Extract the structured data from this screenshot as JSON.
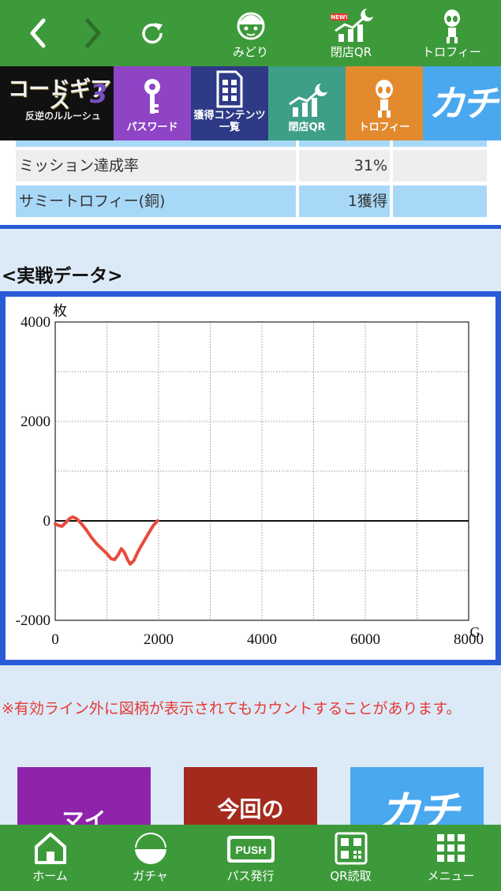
{
  "topbar": {
    "midori_label": "みどり",
    "qr_label": "閉店QR",
    "new_badge": "NEW!",
    "trophy_label": "トロフィー"
  },
  "gamebar": {
    "logo_text": "コードギアス",
    "logo_sub": "反逆のルルーシュ",
    "logo_num": "3",
    "password_label": "パスワード",
    "contents_label_1": "獲得コンテンツ",
    "contents_label_2": "一覧",
    "qr_label": "閉店QR",
    "trophy_label": "トロフィー",
    "kachi_text": "カチ"
  },
  "stats": [
    {
      "label": "ミッション達成率",
      "value": "31%"
    },
    {
      "label": "サミートロフィー(銅)",
      "value": "1獲得"
    }
  ],
  "section_title": "<実戦データ>",
  "chart_data": {
    "type": "line",
    "ylabel": "枚",
    "xlabel": "G",
    "ylim": [
      -2000,
      4000
    ],
    "xlim": [
      0,
      8000
    ],
    "y_ticks": [
      "4000",
      "2000",
      "0",
      "-2000"
    ],
    "x_ticks": [
      "0",
      "2000",
      "4000",
      "6000",
      "8000"
    ],
    "grid": true,
    "series": [
      {
        "color": "#e84b3c",
        "x": [
          0,
          60,
          130,
          200,
          270,
          340,
          420,
          500,
          600,
          700,
          800,
          900,
          1000,
          1080,
          1150,
          1220,
          1280,
          1340,
          1400,
          1450,
          1520,
          1600,
          1700,
          1800,
          1900,
          1980
        ],
        "y": [
          -60,
          -90,
          -110,
          -40,
          40,
          80,
          40,
          -50,
          -180,
          -330,
          -460,
          -560,
          -660,
          -760,
          -780,
          -680,
          -560,
          -640,
          -780,
          -870,
          -800,
          -620,
          -440,
          -260,
          -90,
          0
        ]
      }
    ]
  },
  "note": "※有効ライン外に図柄が表示されてもカウントすることがあります。",
  "cards": [
    "マイ",
    "今回の",
    "カチ"
  ],
  "bottombar": {
    "home": "ホーム",
    "gacha": "ガチャ",
    "pass": "パス発行",
    "qr": "QR読取",
    "menu": "メニュー",
    "push_text": "PUSH"
  }
}
